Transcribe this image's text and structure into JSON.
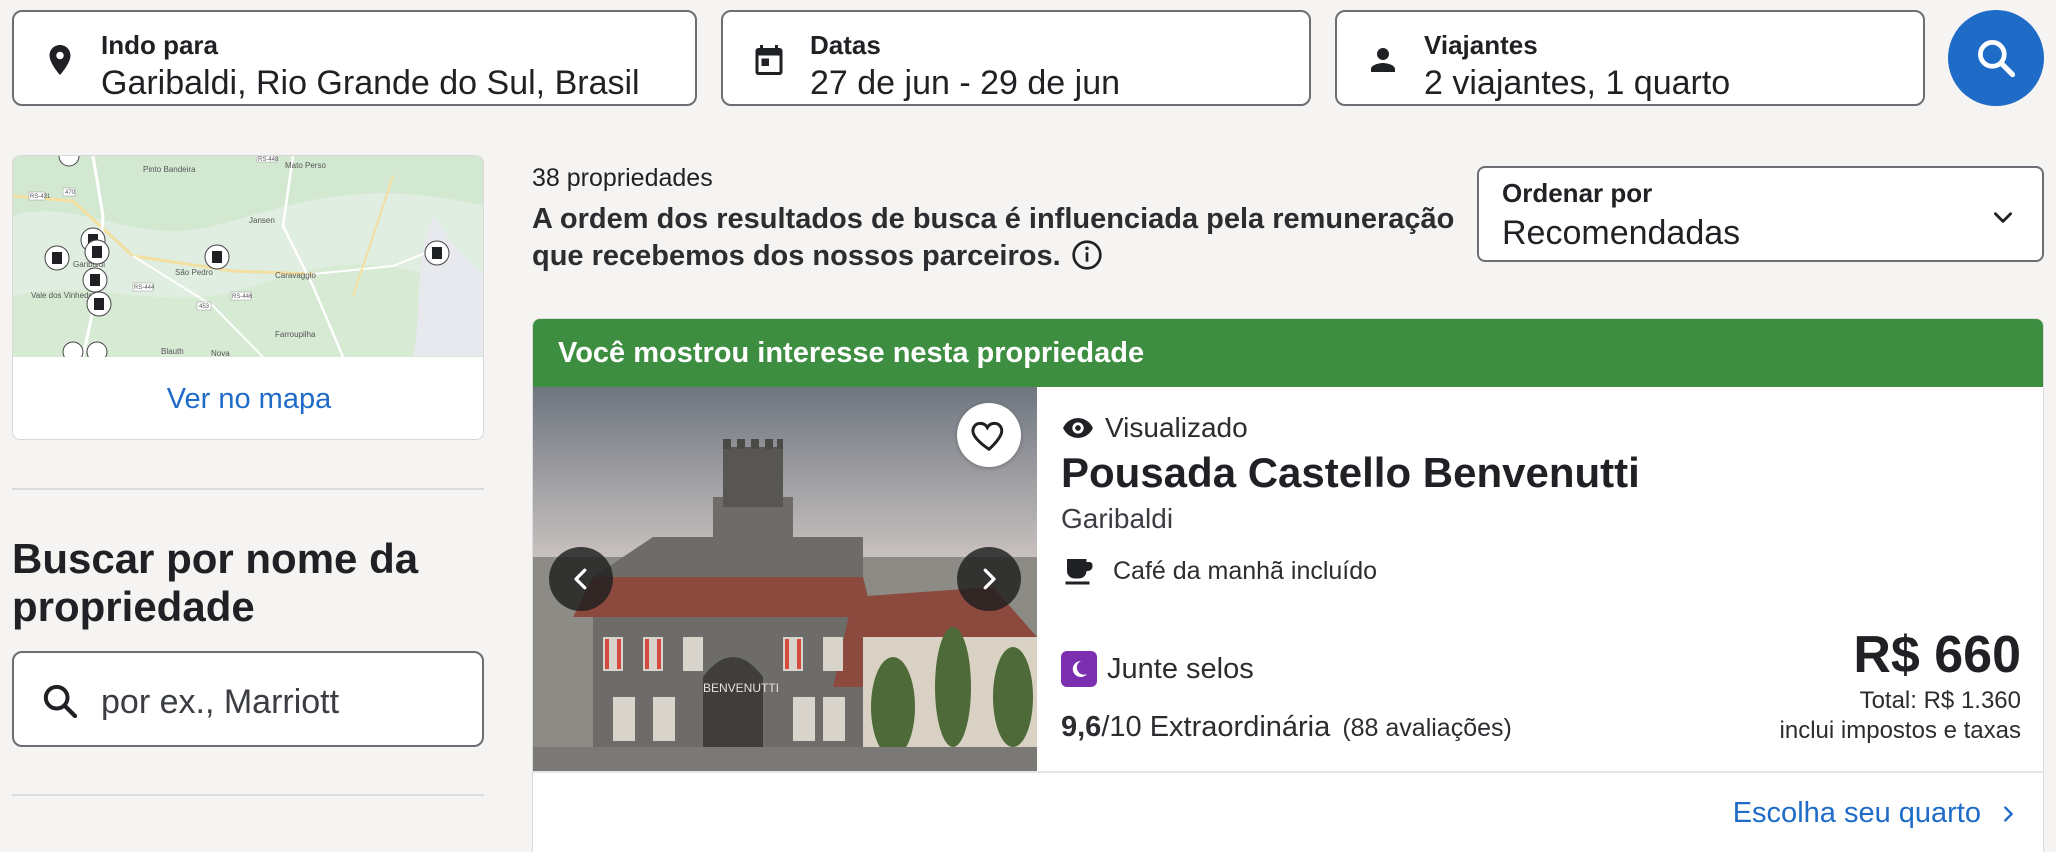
{
  "search": {
    "destination": {
      "label": "Indo para",
      "value": "Garibaldi, Rio Grande do Sul, Brasil",
      "icon": "location-pin-icon"
    },
    "dates": {
      "label": "Datas",
      "value": "27 de jun - 29 de jun",
      "icon": "calendar-icon"
    },
    "travelers": {
      "label": "Viajantes",
      "value": "2 viajantes, 1 quarto",
      "icon": "person-icon"
    },
    "button_icon": "search-icon"
  },
  "map": {
    "link_label": "Ver no mapa",
    "places": [
      "Pinto Bandeira",
      "Mato Perso",
      "Jansen",
      "Garibaldi",
      "Caravaggio",
      "São Pedro",
      "Vale dos Vinhedos",
      "Farroupilha",
      "Blauth",
      "Nova"
    ],
    "roads": [
      "RS-431",
      "470",
      "RS-448",
      "RS-444",
      "453",
      "RS-446"
    ]
  },
  "filters": {
    "name_search": {
      "title": "Buscar por nome da propriedade",
      "placeholder": "por ex., Marriott"
    }
  },
  "results": {
    "count_text": "38 propriedades",
    "notice": "A ordem dos resultados de busca é influenciada pela remuneração que recebemos dos nossos parceiros.",
    "sort": {
      "label": "Ordenar por",
      "value": "Recomendadas"
    }
  },
  "property": {
    "banner": "Você mostrou interesse nesta propriedade",
    "viewed": "Visualizado",
    "name": "Pousada Castello Benvenutti",
    "city": "Garibaldi",
    "amenity": "Café da manhã incluído",
    "stamps": "Junte selos",
    "rating_score": "9,6",
    "rating_scale": "/10",
    "rating_label": "Extraordinária",
    "reviews": "(88 avaliações)",
    "price": "R$ 660",
    "total": "Total: R$ 1.360",
    "taxes": "inclui impostos e taxas",
    "cta": "Escolha seu quarto",
    "photo_sign": "BENVENUTTI"
  },
  "colors": {
    "accent": "#1f6bc8",
    "banner": "#3e8e41",
    "stamp": "#7b2fb0"
  }
}
